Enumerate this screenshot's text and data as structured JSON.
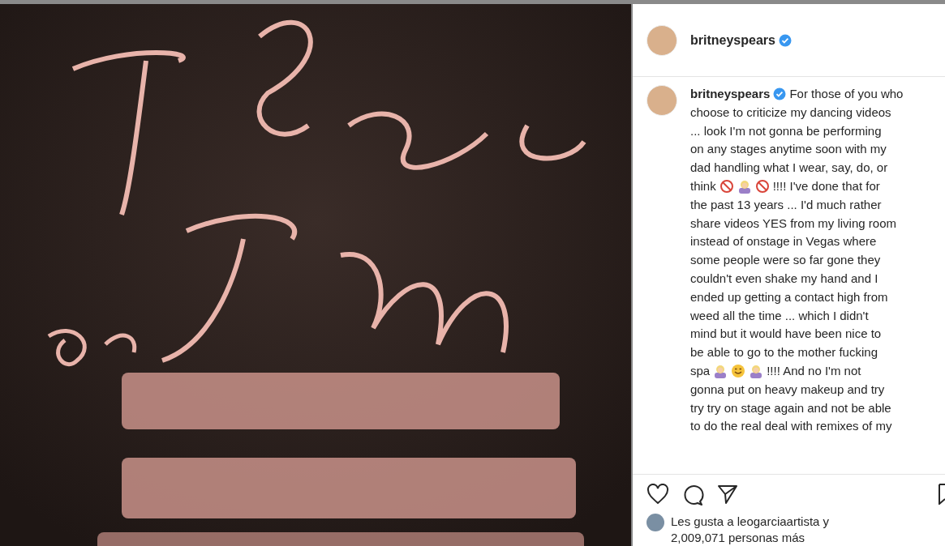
{
  "post": {
    "header": {
      "username": "britneyspears",
      "verified": true
    },
    "caption": {
      "username": "britneyspears",
      "verified": true,
      "lines": [
        [
          {
            "kind": "text",
            "text": "For those of you who"
          }
        ],
        [
          {
            "kind": "text",
            "text": "choose to criticize my dancing videos"
          }
        ],
        [
          {
            "kind": "text",
            "text": "... look I'm not gonna be performing"
          }
        ],
        [
          {
            "kind": "text",
            "text": "on any stages anytime soon with my"
          }
        ],
        [
          {
            "kind": "text",
            "text": "dad handling what I wear, say, do, or"
          }
        ],
        [
          {
            "kind": "text",
            "text": "think"
          },
          {
            "kind": "prohibited"
          },
          {
            "kind": "person"
          },
          {
            "kind": "prohibited"
          },
          {
            "kind": "text",
            "text": "!!!! I've done that for"
          }
        ],
        [
          {
            "kind": "text",
            "text": "the past 13 years ... I'd much rather"
          }
        ],
        [
          {
            "kind": "text",
            "text": "share videos YES from my living room"
          }
        ],
        [
          {
            "kind": "text",
            "text": "instead of onstage in Vegas where"
          }
        ],
        [
          {
            "kind": "text",
            "text": "some people were so far gone they"
          }
        ],
        [
          {
            "kind": "text",
            "text": "couldn't even shake my hand and I"
          }
        ],
        [
          {
            "kind": "text",
            "text": "ended up getting a contact high from"
          }
        ],
        [
          {
            "kind": "text",
            "text": "weed all the time ... which I didn't"
          }
        ],
        [
          {
            "kind": "text",
            "text": "mind but it would have been nice to"
          }
        ],
        [
          {
            "kind": "text",
            "text": "be able to go to the mother fucking"
          }
        ],
        [
          {
            "kind": "text",
            "text": "spa"
          },
          {
            "kind": "person"
          },
          {
            "kind": "smile"
          },
          {
            "kind": "person"
          },
          {
            "kind": "text",
            "text": "!!!! And no I'm not"
          }
        ],
        [
          {
            "kind": "text",
            "text": "gonna put on heavy makeup and try"
          }
        ],
        [
          {
            "kind": "text",
            "text": "try try on stage again and not be able"
          }
        ],
        [
          {
            "kind": "text",
            "text": "to do the real deal with remixes of my"
          }
        ]
      ]
    },
    "likes": {
      "text": "Les gusta a leogarciaartista y 2,009,071 personas más"
    }
  }
}
